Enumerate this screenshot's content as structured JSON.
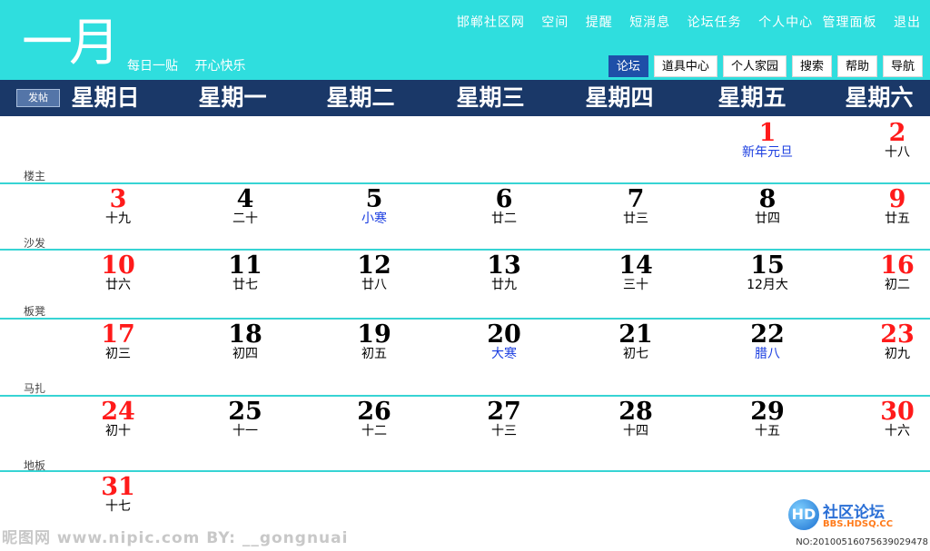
{
  "header": {
    "month": "一月",
    "slogan": [
      "每日一贴",
      "开心快乐"
    ],
    "top_nav": [
      "邯郸社区网",
      "空间",
      "提醒",
      "短消息",
      "论坛任务",
      "个人中心",
      "管理面板",
      "退出"
    ],
    "tabs": [
      {
        "label": "论坛",
        "active": true
      },
      {
        "label": "道具中心",
        "active": false
      },
      {
        "label": "个人家园",
        "active": false
      },
      {
        "label": "搜索",
        "active": false
      },
      {
        "label": "帮助",
        "active": false
      },
      {
        "label": "导航",
        "active": false
      }
    ]
  },
  "weekbar": {
    "post_button": "发帖",
    "days": [
      "星期日",
      "星期一",
      "星期二",
      "星期三",
      "星期四",
      "星期五",
      "星期六"
    ]
  },
  "colors": {
    "header_bg": "#2fdede",
    "weekbar_bg": "#1a3868",
    "weekend": "#ff1a1a",
    "festival": "#1a3de0",
    "row_line": "#37d4d4"
  },
  "rows": [
    {
      "label": "楼主",
      "cells": [
        null,
        null,
        null,
        null,
        null,
        {
          "day": "1",
          "lunar": "新年元旦",
          "red": true,
          "blue": true
        },
        {
          "day": "2",
          "lunar": "十八",
          "red": true,
          "blue": false
        }
      ]
    },
    {
      "label": "沙发",
      "cells": [
        {
          "day": "3",
          "lunar": "十九",
          "red": true,
          "blue": false
        },
        {
          "day": "4",
          "lunar": "二十",
          "red": false,
          "blue": false
        },
        {
          "day": "5",
          "lunar": "小寒",
          "red": false,
          "blue": true
        },
        {
          "day": "6",
          "lunar": "廿二",
          "red": false,
          "blue": false
        },
        {
          "day": "7",
          "lunar": "廿三",
          "red": false,
          "blue": false
        },
        {
          "day": "8",
          "lunar": "廿四",
          "red": false,
          "blue": false
        },
        {
          "day": "9",
          "lunar": "廿五",
          "red": true,
          "blue": false
        }
      ]
    },
    {
      "label": "板凳",
      "cells": [
        {
          "day": "10",
          "lunar": "廿六",
          "red": true,
          "blue": false
        },
        {
          "day": "11",
          "lunar": "廿七",
          "red": false,
          "blue": false
        },
        {
          "day": "12",
          "lunar": "廿八",
          "red": false,
          "blue": false
        },
        {
          "day": "13",
          "lunar": "廿九",
          "red": false,
          "blue": false
        },
        {
          "day": "14",
          "lunar": "三十",
          "red": false,
          "blue": false
        },
        {
          "day": "15",
          "lunar": "12月大",
          "red": false,
          "blue": false
        },
        {
          "day": "16",
          "lunar": "初二",
          "red": true,
          "blue": false
        }
      ]
    },
    {
      "label": "马扎",
      "cells": [
        {
          "day": "17",
          "lunar": "初三",
          "red": true,
          "blue": false
        },
        {
          "day": "18",
          "lunar": "初四",
          "red": false,
          "blue": false
        },
        {
          "day": "19",
          "lunar": "初五",
          "red": false,
          "blue": false
        },
        {
          "day": "20",
          "lunar": "大寒",
          "red": false,
          "blue": true
        },
        {
          "day": "21",
          "lunar": "初七",
          "red": false,
          "blue": false
        },
        {
          "day": "22",
          "lunar": "腊八",
          "red": false,
          "blue": true
        },
        {
          "day": "23",
          "lunar": "初九",
          "red": true,
          "blue": false
        }
      ]
    },
    {
      "label": "地板",
      "cells": [
        {
          "day": "24",
          "lunar": "初十",
          "red": true,
          "blue": false
        },
        {
          "day": "25",
          "lunar": "十一",
          "red": false,
          "blue": false
        },
        {
          "day": "26",
          "lunar": "十二",
          "red": false,
          "blue": false
        },
        {
          "day": "27",
          "lunar": "十三",
          "red": false,
          "blue": false
        },
        {
          "day": "28",
          "lunar": "十四",
          "red": false,
          "blue": false
        },
        {
          "day": "29",
          "lunar": "十五",
          "red": false,
          "blue": false
        },
        {
          "day": "30",
          "lunar": "十六",
          "red": true,
          "blue": false
        }
      ]
    },
    {
      "label": "",
      "cells": [
        {
          "day": "31",
          "lunar": "十七",
          "red": true,
          "blue": false
        },
        null,
        null,
        null,
        null,
        null,
        null
      ]
    }
  ],
  "footer": {
    "watermark": "昵图网 www.nipic.com   BY: __gongnuai",
    "logo_mark": "HD",
    "logo_title": "社区论坛",
    "logo_url": "BBS.HDSQ.CC",
    "serial": "NO:20100516075639029478"
  }
}
